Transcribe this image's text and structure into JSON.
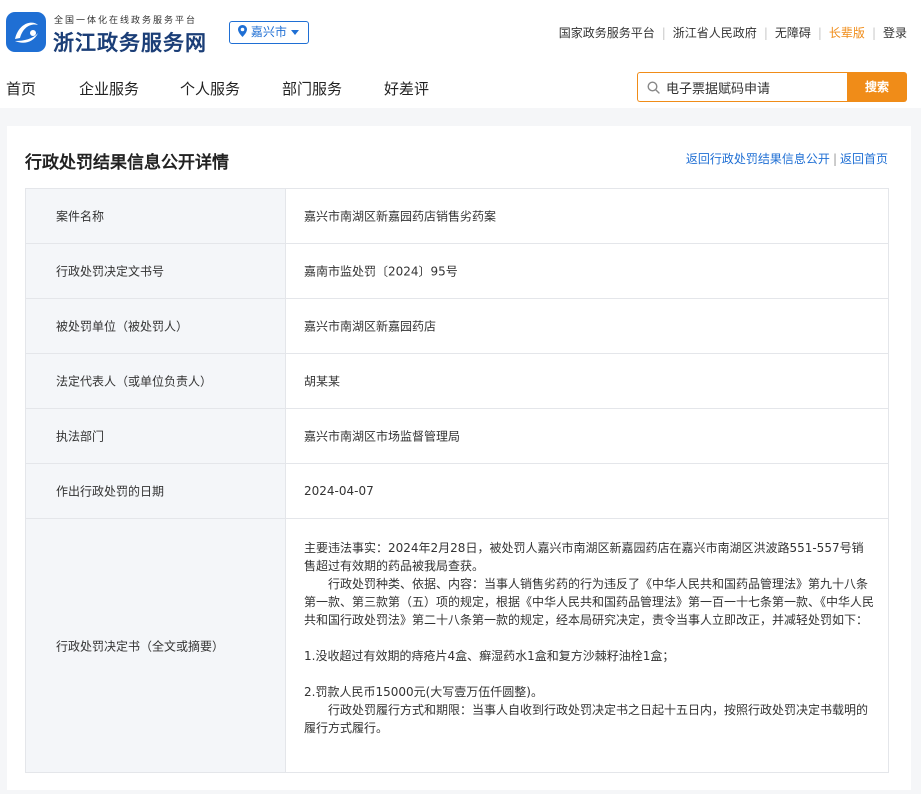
{
  "header": {
    "platform_tagline": "全国一体化在线政务服务平台",
    "site_name": "浙江政务服务网",
    "city": "嘉兴市",
    "top_links": [
      "国家政务服务平台",
      "浙江省人民政府",
      "无障碍",
      "长辈版",
      "登录"
    ]
  },
  "nav": {
    "items": [
      "首页",
      "企业服务",
      "个人服务",
      "部门服务",
      "好差评"
    ],
    "search_value": "电子票据赋码申请",
    "search_button": "搜索"
  },
  "page": {
    "title": "行政处罚结果信息公开详情",
    "link_back_list": "返回行政处罚结果信息公开",
    "link_separator": "|",
    "link_home": "返回首页"
  },
  "fields": [
    {
      "label": "案件名称",
      "value": "嘉兴市南湖区新嘉园药店销售劣药案"
    },
    {
      "label": "行政处罚决定文书号",
      "value": "嘉南市监处罚〔2024〕95号"
    },
    {
      "label": "被处罚单位（被处罚人）",
      "value": "嘉兴市南湖区新嘉园药店"
    },
    {
      "label": "法定代表人（或单位负责人）",
      "value": "胡某某"
    },
    {
      "label": "执法部门",
      "value": "嘉兴市南湖区市场监督管理局"
    },
    {
      "label": "作出行政处罚的日期",
      "value": "2024-04-07"
    }
  ],
  "decision": {
    "label": "行政处罚决定书（全文或摘要）",
    "paragraphs": [
      "主要违法事实：2024年2月28日，被处罚人嘉兴市南湖区新嘉园药店在嘉兴市南湖区洪波路551-557号销售超过有效期的药品被我局查获。",
      "　　行政处罚种类、依据、内容：当事人销售劣药的行为违反了《中华人民共和国药品管理法》第九十八条第一款、第三款第（五）项的规定，根据《中华人民共和国药品管理法》第一百一十七条第一款、《中华人民共和国行政处罚法》第二十八条第一款的规定，经本局研究决定，责令当事人立即改正，并减轻处罚如下：",
      "1.没收超过有效期的痔疮片4盒、癣湿药水1盒和复方沙棘籽油栓1盒；",
      "2.罚款人民币15000元(大写壹万伍仟圆整)。",
      "　　行政处罚履行方式和期限：当事人自收到行政处罚决定书之日起十五日内，按照行政处罚决定书载明的履行方式履行。"
    ]
  },
  "colors": {
    "brand_blue": "#1f6fd4",
    "accent_orange": "#f08c18",
    "label_bg": "#f4f6f9"
  },
  "icons": [
    "logo-icon",
    "location-pin-icon",
    "chevron-down-icon",
    "search-icon"
  ]
}
